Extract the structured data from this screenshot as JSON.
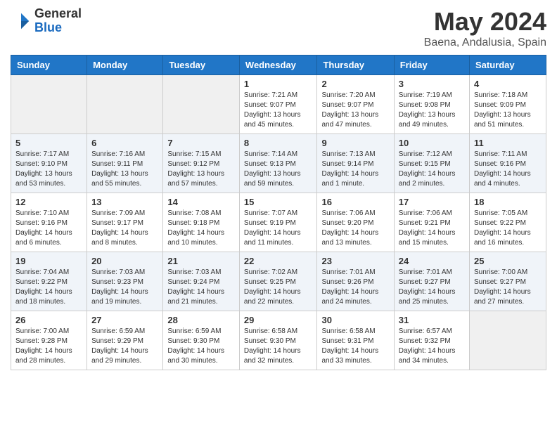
{
  "header": {
    "logo_general": "General",
    "logo_blue": "Blue",
    "month": "May 2024",
    "location": "Baena, Andalusia, Spain"
  },
  "days_of_week": [
    "Sunday",
    "Monday",
    "Tuesday",
    "Wednesday",
    "Thursday",
    "Friday",
    "Saturday"
  ],
  "weeks": [
    [
      {
        "day": "",
        "sunrise": "",
        "sunset": "",
        "daylight": "",
        "empty": true
      },
      {
        "day": "",
        "sunrise": "",
        "sunset": "",
        "daylight": "",
        "empty": true
      },
      {
        "day": "",
        "sunrise": "",
        "sunset": "",
        "daylight": "",
        "empty": true
      },
      {
        "day": "1",
        "sunrise": "Sunrise: 7:21 AM",
        "sunset": "Sunset: 9:07 PM",
        "daylight": "Daylight: 13 hours and 45 minutes.",
        "empty": false
      },
      {
        "day": "2",
        "sunrise": "Sunrise: 7:20 AM",
        "sunset": "Sunset: 9:07 PM",
        "daylight": "Daylight: 13 hours and 47 minutes.",
        "empty": false
      },
      {
        "day": "3",
        "sunrise": "Sunrise: 7:19 AM",
        "sunset": "Sunset: 9:08 PM",
        "daylight": "Daylight: 13 hours and 49 minutes.",
        "empty": false
      },
      {
        "day": "4",
        "sunrise": "Sunrise: 7:18 AM",
        "sunset": "Sunset: 9:09 PM",
        "daylight": "Daylight: 13 hours and 51 minutes.",
        "empty": false
      }
    ],
    [
      {
        "day": "5",
        "sunrise": "Sunrise: 7:17 AM",
        "sunset": "Sunset: 9:10 PM",
        "daylight": "Daylight: 13 hours and 53 minutes.",
        "empty": false
      },
      {
        "day": "6",
        "sunrise": "Sunrise: 7:16 AM",
        "sunset": "Sunset: 9:11 PM",
        "daylight": "Daylight: 13 hours and 55 minutes.",
        "empty": false
      },
      {
        "day": "7",
        "sunrise": "Sunrise: 7:15 AM",
        "sunset": "Sunset: 9:12 PM",
        "daylight": "Daylight: 13 hours and 57 minutes.",
        "empty": false
      },
      {
        "day": "8",
        "sunrise": "Sunrise: 7:14 AM",
        "sunset": "Sunset: 9:13 PM",
        "daylight": "Daylight: 13 hours and 59 minutes.",
        "empty": false
      },
      {
        "day": "9",
        "sunrise": "Sunrise: 7:13 AM",
        "sunset": "Sunset: 9:14 PM",
        "daylight": "Daylight: 14 hours and 1 minute.",
        "empty": false
      },
      {
        "day": "10",
        "sunrise": "Sunrise: 7:12 AM",
        "sunset": "Sunset: 9:15 PM",
        "daylight": "Daylight: 14 hours and 2 minutes.",
        "empty": false
      },
      {
        "day": "11",
        "sunrise": "Sunrise: 7:11 AM",
        "sunset": "Sunset: 9:16 PM",
        "daylight": "Daylight: 14 hours and 4 minutes.",
        "empty": false
      }
    ],
    [
      {
        "day": "12",
        "sunrise": "Sunrise: 7:10 AM",
        "sunset": "Sunset: 9:16 PM",
        "daylight": "Daylight: 14 hours and 6 minutes.",
        "empty": false
      },
      {
        "day": "13",
        "sunrise": "Sunrise: 7:09 AM",
        "sunset": "Sunset: 9:17 PM",
        "daylight": "Daylight: 14 hours and 8 minutes.",
        "empty": false
      },
      {
        "day": "14",
        "sunrise": "Sunrise: 7:08 AM",
        "sunset": "Sunset: 9:18 PM",
        "daylight": "Daylight: 14 hours and 10 minutes.",
        "empty": false
      },
      {
        "day": "15",
        "sunrise": "Sunrise: 7:07 AM",
        "sunset": "Sunset: 9:19 PM",
        "daylight": "Daylight: 14 hours and 11 minutes.",
        "empty": false
      },
      {
        "day": "16",
        "sunrise": "Sunrise: 7:06 AM",
        "sunset": "Sunset: 9:20 PM",
        "daylight": "Daylight: 14 hours and 13 minutes.",
        "empty": false
      },
      {
        "day": "17",
        "sunrise": "Sunrise: 7:06 AM",
        "sunset": "Sunset: 9:21 PM",
        "daylight": "Daylight: 14 hours and 15 minutes.",
        "empty": false
      },
      {
        "day": "18",
        "sunrise": "Sunrise: 7:05 AM",
        "sunset": "Sunset: 9:22 PM",
        "daylight": "Daylight: 14 hours and 16 minutes.",
        "empty": false
      }
    ],
    [
      {
        "day": "19",
        "sunrise": "Sunrise: 7:04 AM",
        "sunset": "Sunset: 9:22 PM",
        "daylight": "Daylight: 14 hours and 18 minutes.",
        "empty": false
      },
      {
        "day": "20",
        "sunrise": "Sunrise: 7:03 AM",
        "sunset": "Sunset: 9:23 PM",
        "daylight": "Daylight: 14 hours and 19 minutes.",
        "empty": false
      },
      {
        "day": "21",
        "sunrise": "Sunrise: 7:03 AM",
        "sunset": "Sunset: 9:24 PM",
        "daylight": "Daylight: 14 hours and 21 minutes.",
        "empty": false
      },
      {
        "day": "22",
        "sunrise": "Sunrise: 7:02 AM",
        "sunset": "Sunset: 9:25 PM",
        "daylight": "Daylight: 14 hours and 22 minutes.",
        "empty": false
      },
      {
        "day": "23",
        "sunrise": "Sunrise: 7:01 AM",
        "sunset": "Sunset: 9:26 PM",
        "daylight": "Daylight: 14 hours and 24 minutes.",
        "empty": false
      },
      {
        "day": "24",
        "sunrise": "Sunrise: 7:01 AM",
        "sunset": "Sunset: 9:27 PM",
        "daylight": "Daylight: 14 hours and 25 minutes.",
        "empty": false
      },
      {
        "day": "25",
        "sunrise": "Sunrise: 7:00 AM",
        "sunset": "Sunset: 9:27 PM",
        "daylight": "Daylight: 14 hours and 27 minutes.",
        "empty": false
      }
    ],
    [
      {
        "day": "26",
        "sunrise": "Sunrise: 7:00 AM",
        "sunset": "Sunset: 9:28 PM",
        "daylight": "Daylight: 14 hours and 28 minutes.",
        "empty": false
      },
      {
        "day": "27",
        "sunrise": "Sunrise: 6:59 AM",
        "sunset": "Sunset: 9:29 PM",
        "daylight": "Daylight: 14 hours and 29 minutes.",
        "empty": false
      },
      {
        "day": "28",
        "sunrise": "Sunrise: 6:59 AM",
        "sunset": "Sunset: 9:30 PM",
        "daylight": "Daylight: 14 hours and 30 minutes.",
        "empty": false
      },
      {
        "day": "29",
        "sunrise": "Sunrise: 6:58 AM",
        "sunset": "Sunset: 9:30 PM",
        "daylight": "Daylight: 14 hours and 32 minutes.",
        "empty": false
      },
      {
        "day": "30",
        "sunrise": "Sunrise: 6:58 AM",
        "sunset": "Sunset: 9:31 PM",
        "daylight": "Daylight: 14 hours and 33 minutes.",
        "empty": false
      },
      {
        "day": "31",
        "sunrise": "Sunrise: 6:57 AM",
        "sunset": "Sunset: 9:32 PM",
        "daylight": "Daylight: 14 hours and 34 minutes.",
        "empty": false
      },
      {
        "day": "",
        "sunrise": "",
        "sunset": "",
        "daylight": "",
        "empty": true
      }
    ]
  ]
}
